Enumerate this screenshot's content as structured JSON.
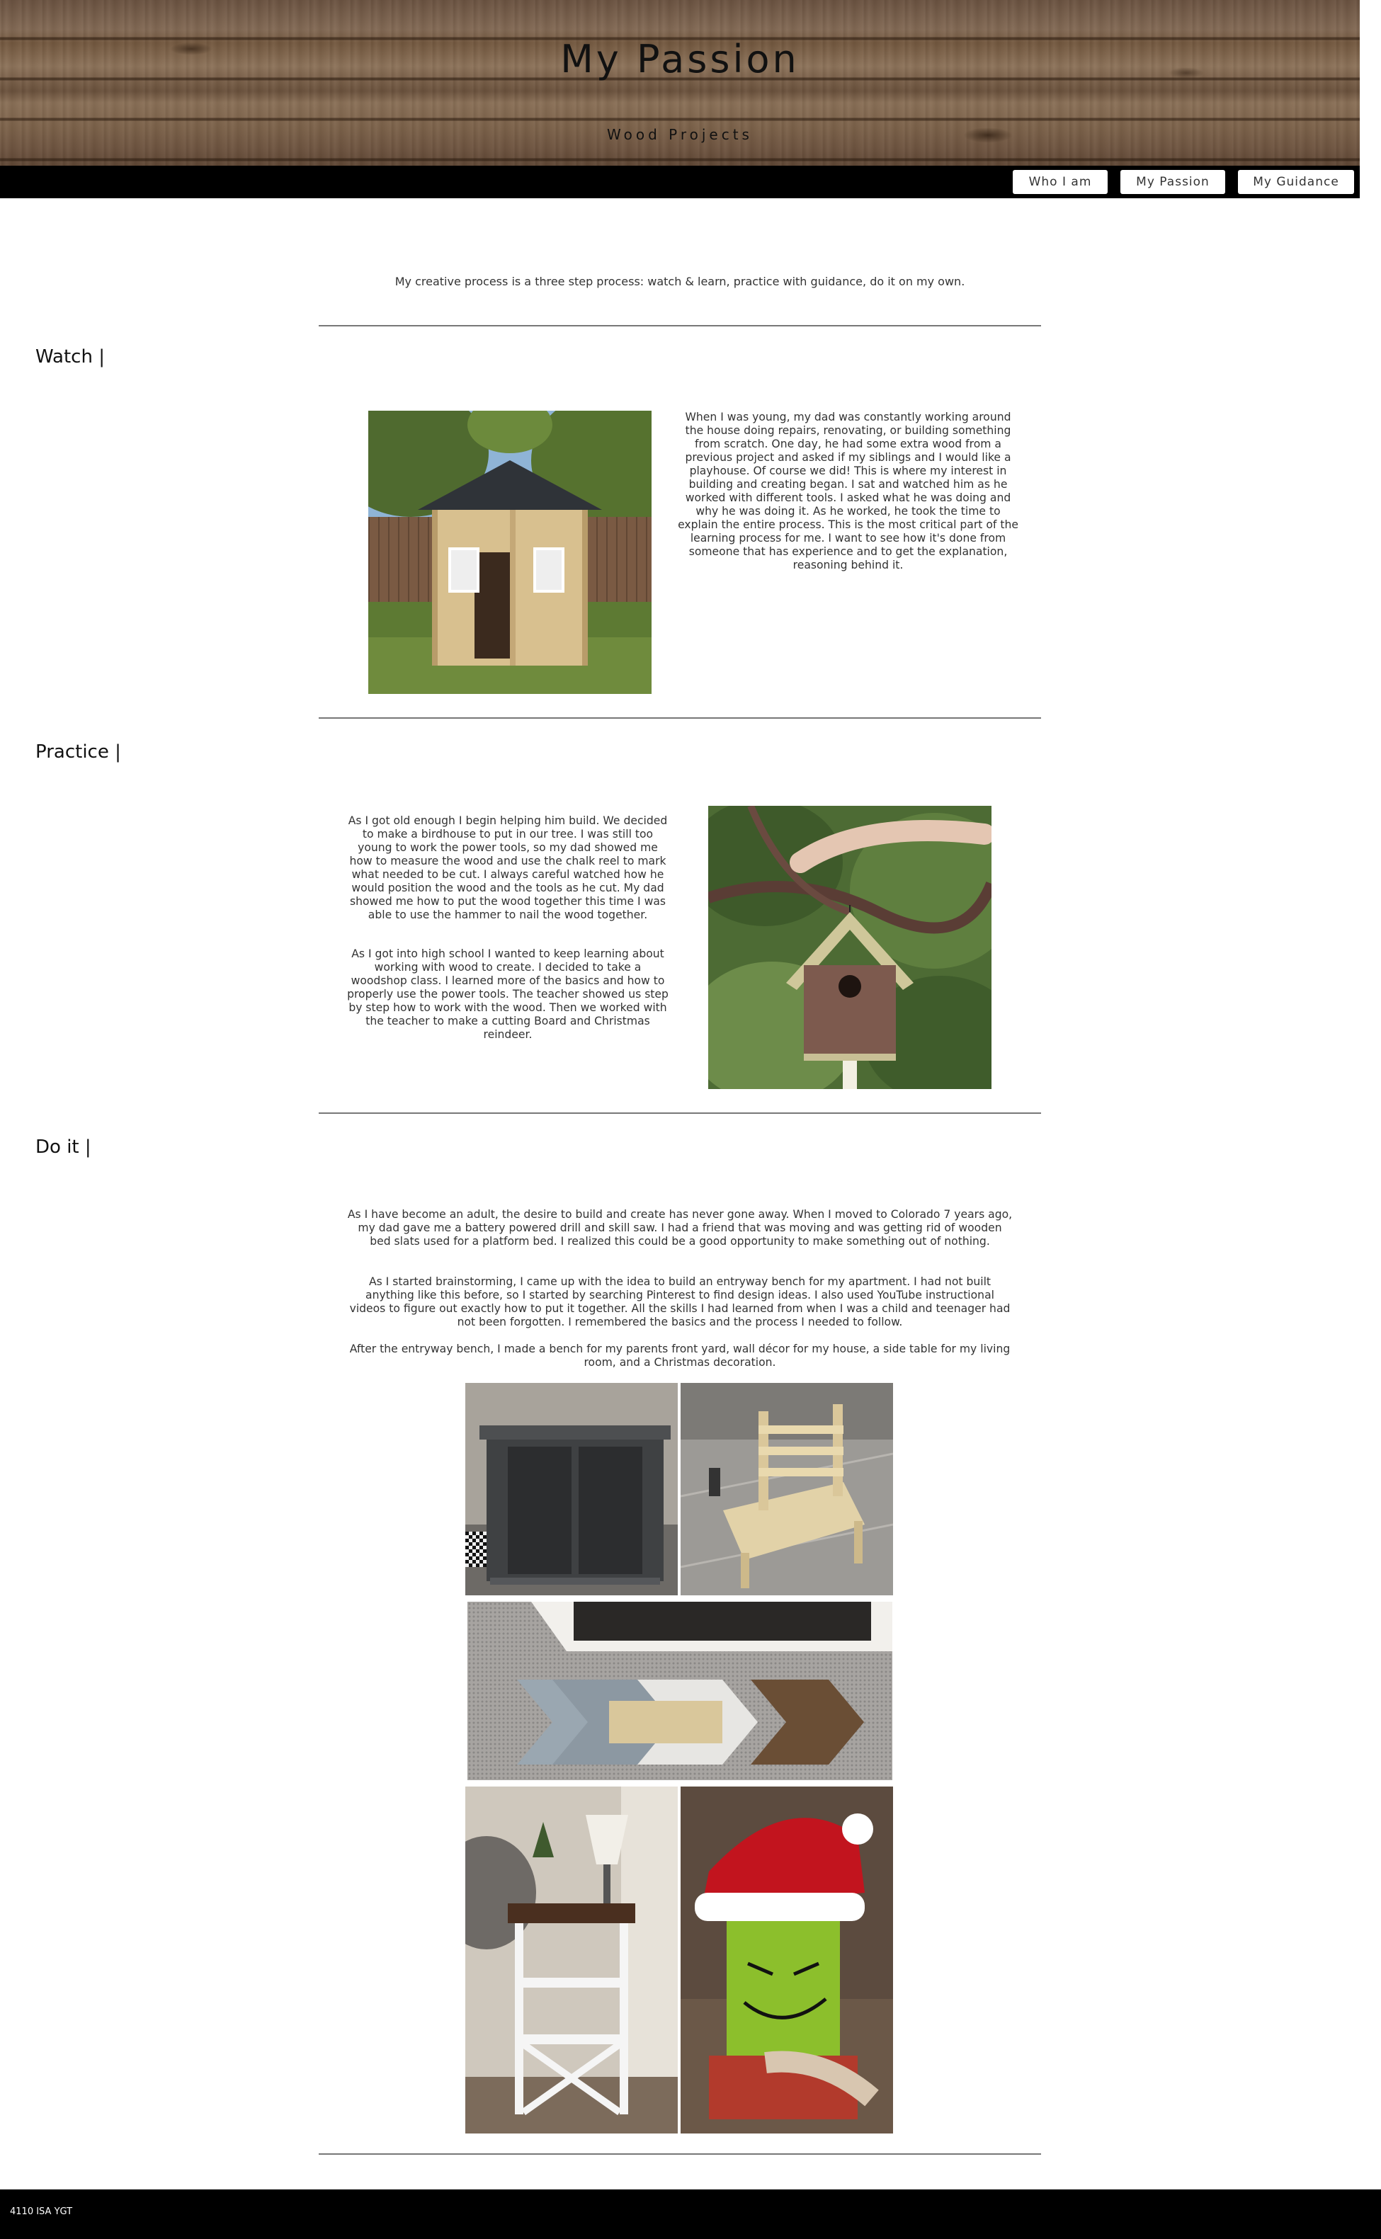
{
  "header": {
    "title": "My Passion",
    "subtitle": "Wood Projects"
  },
  "nav": {
    "items": [
      "Who I am",
      "My Passion",
      "My Guidance"
    ]
  },
  "intro": "My creative process is a three step process: watch & learn, practice with guidance, do it on my own.",
  "watch": {
    "heading": "Watch |",
    "text": "When I was young, my dad was constantly working around the house doing repairs, renovating, or building something from scratch. One day, he had some extra wood from a previous project and asked if my siblings and I would like a playhouse. Of course we did! This is where my interest in building and creating began. I sat and watched him as he worked with different tools. I asked what he was doing and why he was doing it. As he worked, he took the time to explain the entire process. This is the most critical part of the learning process for me. I want to see how it's done from someone that has experience and to get the explanation, reasoning behind it."
  },
  "practice": {
    "heading": "Practice |",
    "text1": "As I got old enough I begin helping him build. We decided to make a birdhouse to put in our tree. I was still too young to work the power tools, so my dad showed me how to measure the wood and use the chalk reel to mark what needed to be cut. I always careful watched how he would position the wood and the tools as he cut. My dad showed me how to put the wood together this time I was able to use the hammer to nail the wood together.",
    "text2": "As I got into high school I wanted to keep learning about working with wood to create. I decided to take a woodshop class. I learned more of the basics and how to properly use the power tools. The teacher showed us step by step how to work with the wood. Then we worked with the teacher to make a cutting Board and Christmas reindeer."
  },
  "doit": {
    "heading": "Do it |",
    "text1": "As I have become an adult, the desire to build and create has never gone away. When I moved to Colorado 7 years ago, my dad gave me a battery powered drill and skill saw. I had a friend that was moving and was getting rid of wooden bed slats used for a platform bed. I realized this could be a good opportunity to make something out of nothing.",
    "text2": "As I started brainstorming, I came up with the idea to build an entryway bench for my apartment. I had not built anything like this before, so I started by searching Pinterest to find design ideas. I also used YouTube instructional videos to figure out exactly how to put it together. All the skills I had learned from when I was a child and teenager had not been forgotten. I remembered the basics and the process I needed to follow.",
    "text3": "After the entryway bench, I made a bench for my parents front yard, wall décor for my house, a side table for my living room, and a Christmas decoration."
  },
  "footer": {
    "text": "4110 ISA YGT"
  },
  "colors": {
    "navbar": "#000000",
    "footer": "#000000",
    "rule": "#777777",
    "wood": "#7b6149"
  }
}
